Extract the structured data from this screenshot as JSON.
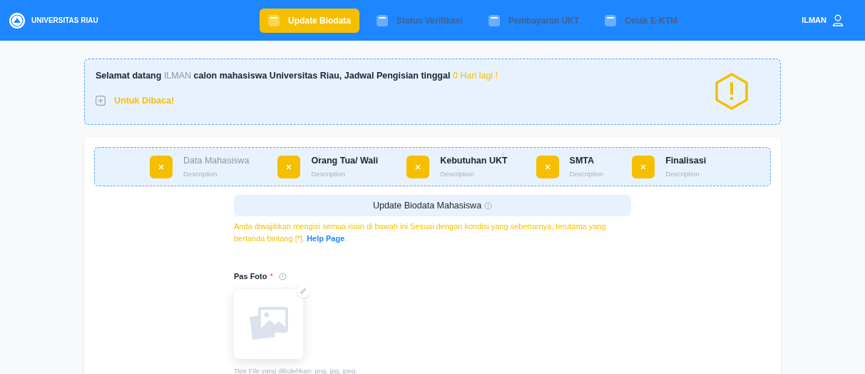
{
  "navbar": {
    "brand": "UNIVERSITAS RIAU",
    "tabs": [
      {
        "label": "Update Biodata",
        "selected": true
      },
      {
        "label": "Status Verifikasi",
        "selected": false
      },
      {
        "label": "Pembayaran UKT",
        "selected": false
      },
      {
        "label": "Cetak E-KTM",
        "selected": false
      }
    ],
    "user": "ILMAN"
  },
  "alert": {
    "message": [
      {
        "kind": "plain",
        "text": "Selamat datang "
      },
      {
        "kind": "name",
        "text": "ILMAN"
      },
      {
        "kind": "plain",
        "text": " calon mahasiswa Universitas Riau, Jadwal Pengisian tinggal "
      },
      {
        "kind": "highlight",
        "text": "0 Hari lagi !"
      }
    ],
    "toggle": "Untuk Dibaca!",
    "expanded": false
  },
  "steps": [
    {
      "title": "Data Mahasiswa",
      "description": "Description",
      "current": true
    },
    {
      "title": "Orang Tua/ Wali",
      "description": "Description",
      "current": false
    },
    {
      "title": "Kebutuhan UKT",
      "description": "Description",
      "current": false
    },
    {
      "title": "SMTA",
      "description": "Description",
      "current": false
    },
    {
      "title": "Finalisasi",
      "description": "Description",
      "current": false
    }
  ],
  "form": {
    "title": "Update Biodata Mahasiswa",
    "notice_before": "Anda diwajibkan mengisi semua isian di bawah ini Sesuai dengan kondisi yang sebenarnya, terutama yang bertanda bintang [*]. ",
    "notice_link": "Help Page",
    "notice_after": ".",
    "photo": {
      "label": "Pas Foto",
      "required_mark": "*",
      "hint": "Tipe File yang dibolehkan: png, jpg, jpeg."
    }
  }
}
